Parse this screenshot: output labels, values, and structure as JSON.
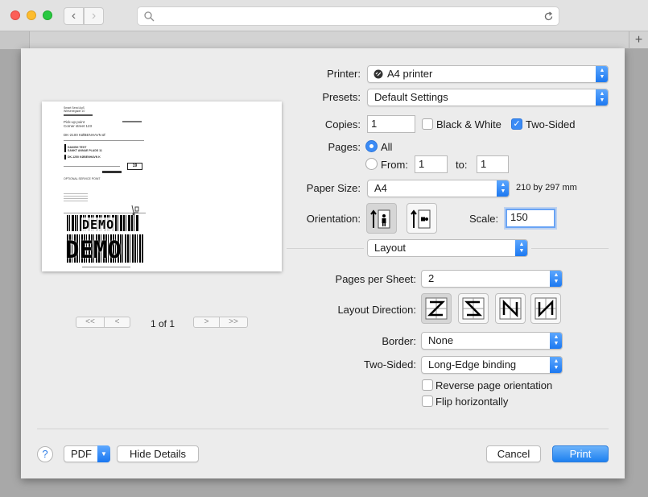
{
  "preview": {
    "label": {
      "sender": [
        "Smart Send ApS",
        "Wiesenegade 10"
      ],
      "pickup_point": [
        "Pick-up point",
        "Corner street 123"
      ],
      "destination": "DK-2100 KØBENHAVN Ø",
      "recipient": [
        "DANISH TEST",
        "SANKT ANNAE PLADS 11",
        "DK-1250 KØBENHAVN K"
      ],
      "parcel_count": "19",
      "service": "OPTIONAL SERVICE POINT",
      "watermark": "DEMO"
    },
    "page_indicator": "1 of 1",
    "nav": {
      "first": "<<",
      "prev": "<",
      "next": ">",
      "last": ">>"
    }
  },
  "printer": {
    "label": "Printer:",
    "value": "A4 printer"
  },
  "presets": {
    "label": "Presets:",
    "value": "Default Settings"
  },
  "copies": {
    "label": "Copies:",
    "value": "1",
    "bw_label": "Black & White",
    "bw_checked": false,
    "twosided_label": "Two-Sided",
    "twosided_checked": true
  },
  "pages": {
    "label": "Pages:",
    "all_label": "All",
    "from_label": "From:",
    "from_value": "1",
    "to_label": "to:",
    "to_value": "1"
  },
  "paper_size": {
    "label": "Paper Size:",
    "value": "A4",
    "dimensions": "210 by 297 mm"
  },
  "orientation": {
    "label": "Orientation:",
    "selected": "portrait"
  },
  "scale": {
    "label": "Scale:",
    "value": "150"
  },
  "section": {
    "value": "Layout"
  },
  "layout": {
    "pages_per_sheet": {
      "label": "Pages per Sheet:",
      "value": "2"
    },
    "direction_label": "Layout Direction:",
    "border": {
      "label": "Border:",
      "value": "None"
    },
    "two_sided": {
      "label": "Two-Sided:",
      "value": "Long-Edge binding"
    },
    "reverse_label": "Reverse page orientation",
    "flip_label": "Flip horizontally"
  },
  "footer": {
    "help": "?",
    "pdf": "PDF",
    "hide_details": "Hide Details",
    "cancel": "Cancel",
    "print": "Print"
  },
  "colors": {
    "accent": "#1e80f0"
  }
}
